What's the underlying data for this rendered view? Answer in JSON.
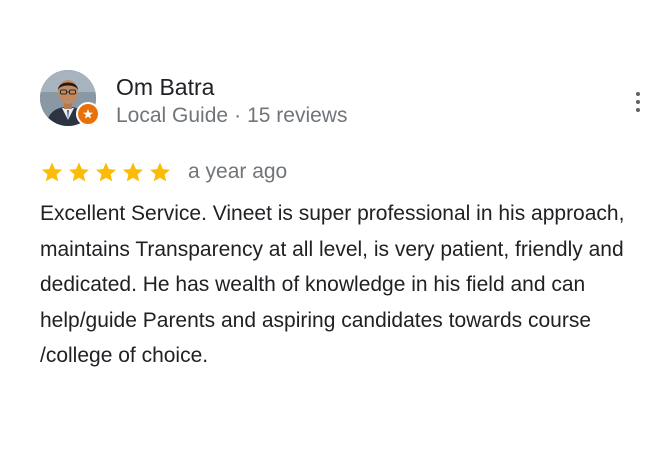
{
  "review": {
    "reviewer_name": "Om Batra",
    "reviewer_role": "Local Guide",
    "separator": "·",
    "review_count": "15 reviews",
    "rating": 5,
    "rating_max": 5,
    "time_ago": "a year ago",
    "text": "Excellent Service. Vineet is super professional in his approach, maintains Transparency at all level, is very patient, friendly and dedicated. He has wealth of knowledge in his field and can help/guide Parents and aspiring candidates towards course /college of choice."
  },
  "colors": {
    "star": "#fbbc04",
    "local_guide_badge": "#e8710a",
    "secondary_text": "#70757a"
  },
  "icons": {
    "more": "more-vert-icon",
    "badge": "local-guide-badge-icon",
    "star": "star-icon"
  }
}
